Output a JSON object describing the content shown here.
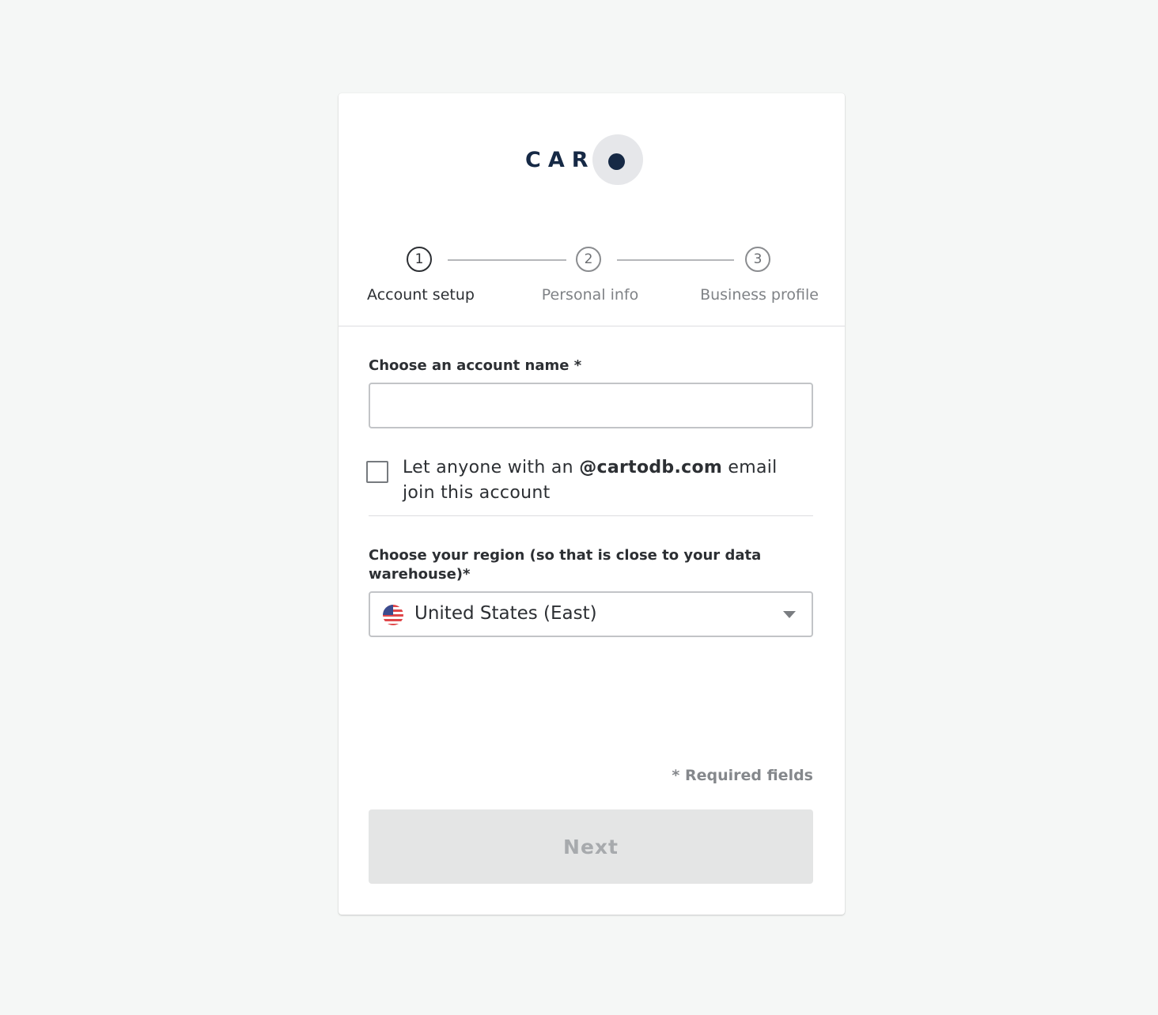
{
  "brand": {
    "logo_text": "CART",
    "logo_alt": "CARTO"
  },
  "stepper": {
    "steps": [
      {
        "number": "1",
        "label": "Account setup",
        "state": "active"
      },
      {
        "number": "2",
        "label": "Personal info",
        "state": "inactive"
      },
      {
        "number": "3",
        "label": "Business profile",
        "state": "inactive"
      }
    ]
  },
  "form": {
    "account_name": {
      "label": "Choose an account name *",
      "value": "",
      "placeholder": ""
    },
    "domain_join": {
      "prefix": "Let anyone with an ",
      "domain": "@cartodb.com",
      "suffix": " email join this account",
      "checked": false
    },
    "region": {
      "label": "Choose your region (so that is close to your data warehouse)*",
      "selected": "United States (East)",
      "flag_icon": "us-flag-icon"
    },
    "required_note": "* Required fields",
    "next_label": "Next"
  },
  "colors": {
    "brand_navy": "#162945",
    "page_bg": "#f5f7f6",
    "disabled_button_bg": "#e4e5e5"
  }
}
